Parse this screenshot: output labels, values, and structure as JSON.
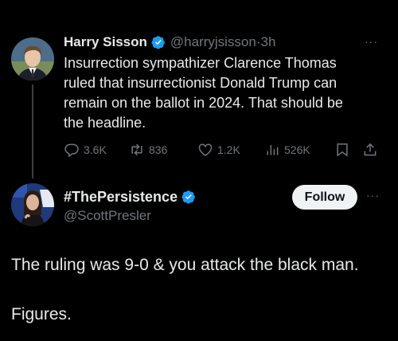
{
  "tweet": {
    "author_name": "Harry Sisson",
    "author_handle": "@harryjsisson",
    "timestamp": "3h",
    "separator": "·",
    "body_lines": [
      "Insurrection sympathizer Clarence Thomas",
      "ruled that insurrectionist Donald Trump can",
      "remain on the ballot in 2024. That should be",
      "the headline."
    ],
    "actions": {
      "replies": "3.6K",
      "reposts": "836",
      "likes": "1.2K",
      "views": "526K"
    }
  },
  "reply": {
    "author_name": "#ThePersistence",
    "author_handle": "@ScottPresler",
    "follow_label": "Follow",
    "text_line1": "The ruling was 9-0 & you attack the black man.",
    "text_line2": "Figures."
  },
  "colors": {
    "background": "#000000",
    "text": "#e7e9ea",
    "muted": "#71767b",
    "verified": "#1d9bf0",
    "follow_bg": "#eff3f4"
  },
  "icons": [
    "verified-badge-icon",
    "reply-icon",
    "repost-icon",
    "like-icon",
    "views-icon",
    "bookmark-icon",
    "share-icon",
    "more-icon"
  ]
}
